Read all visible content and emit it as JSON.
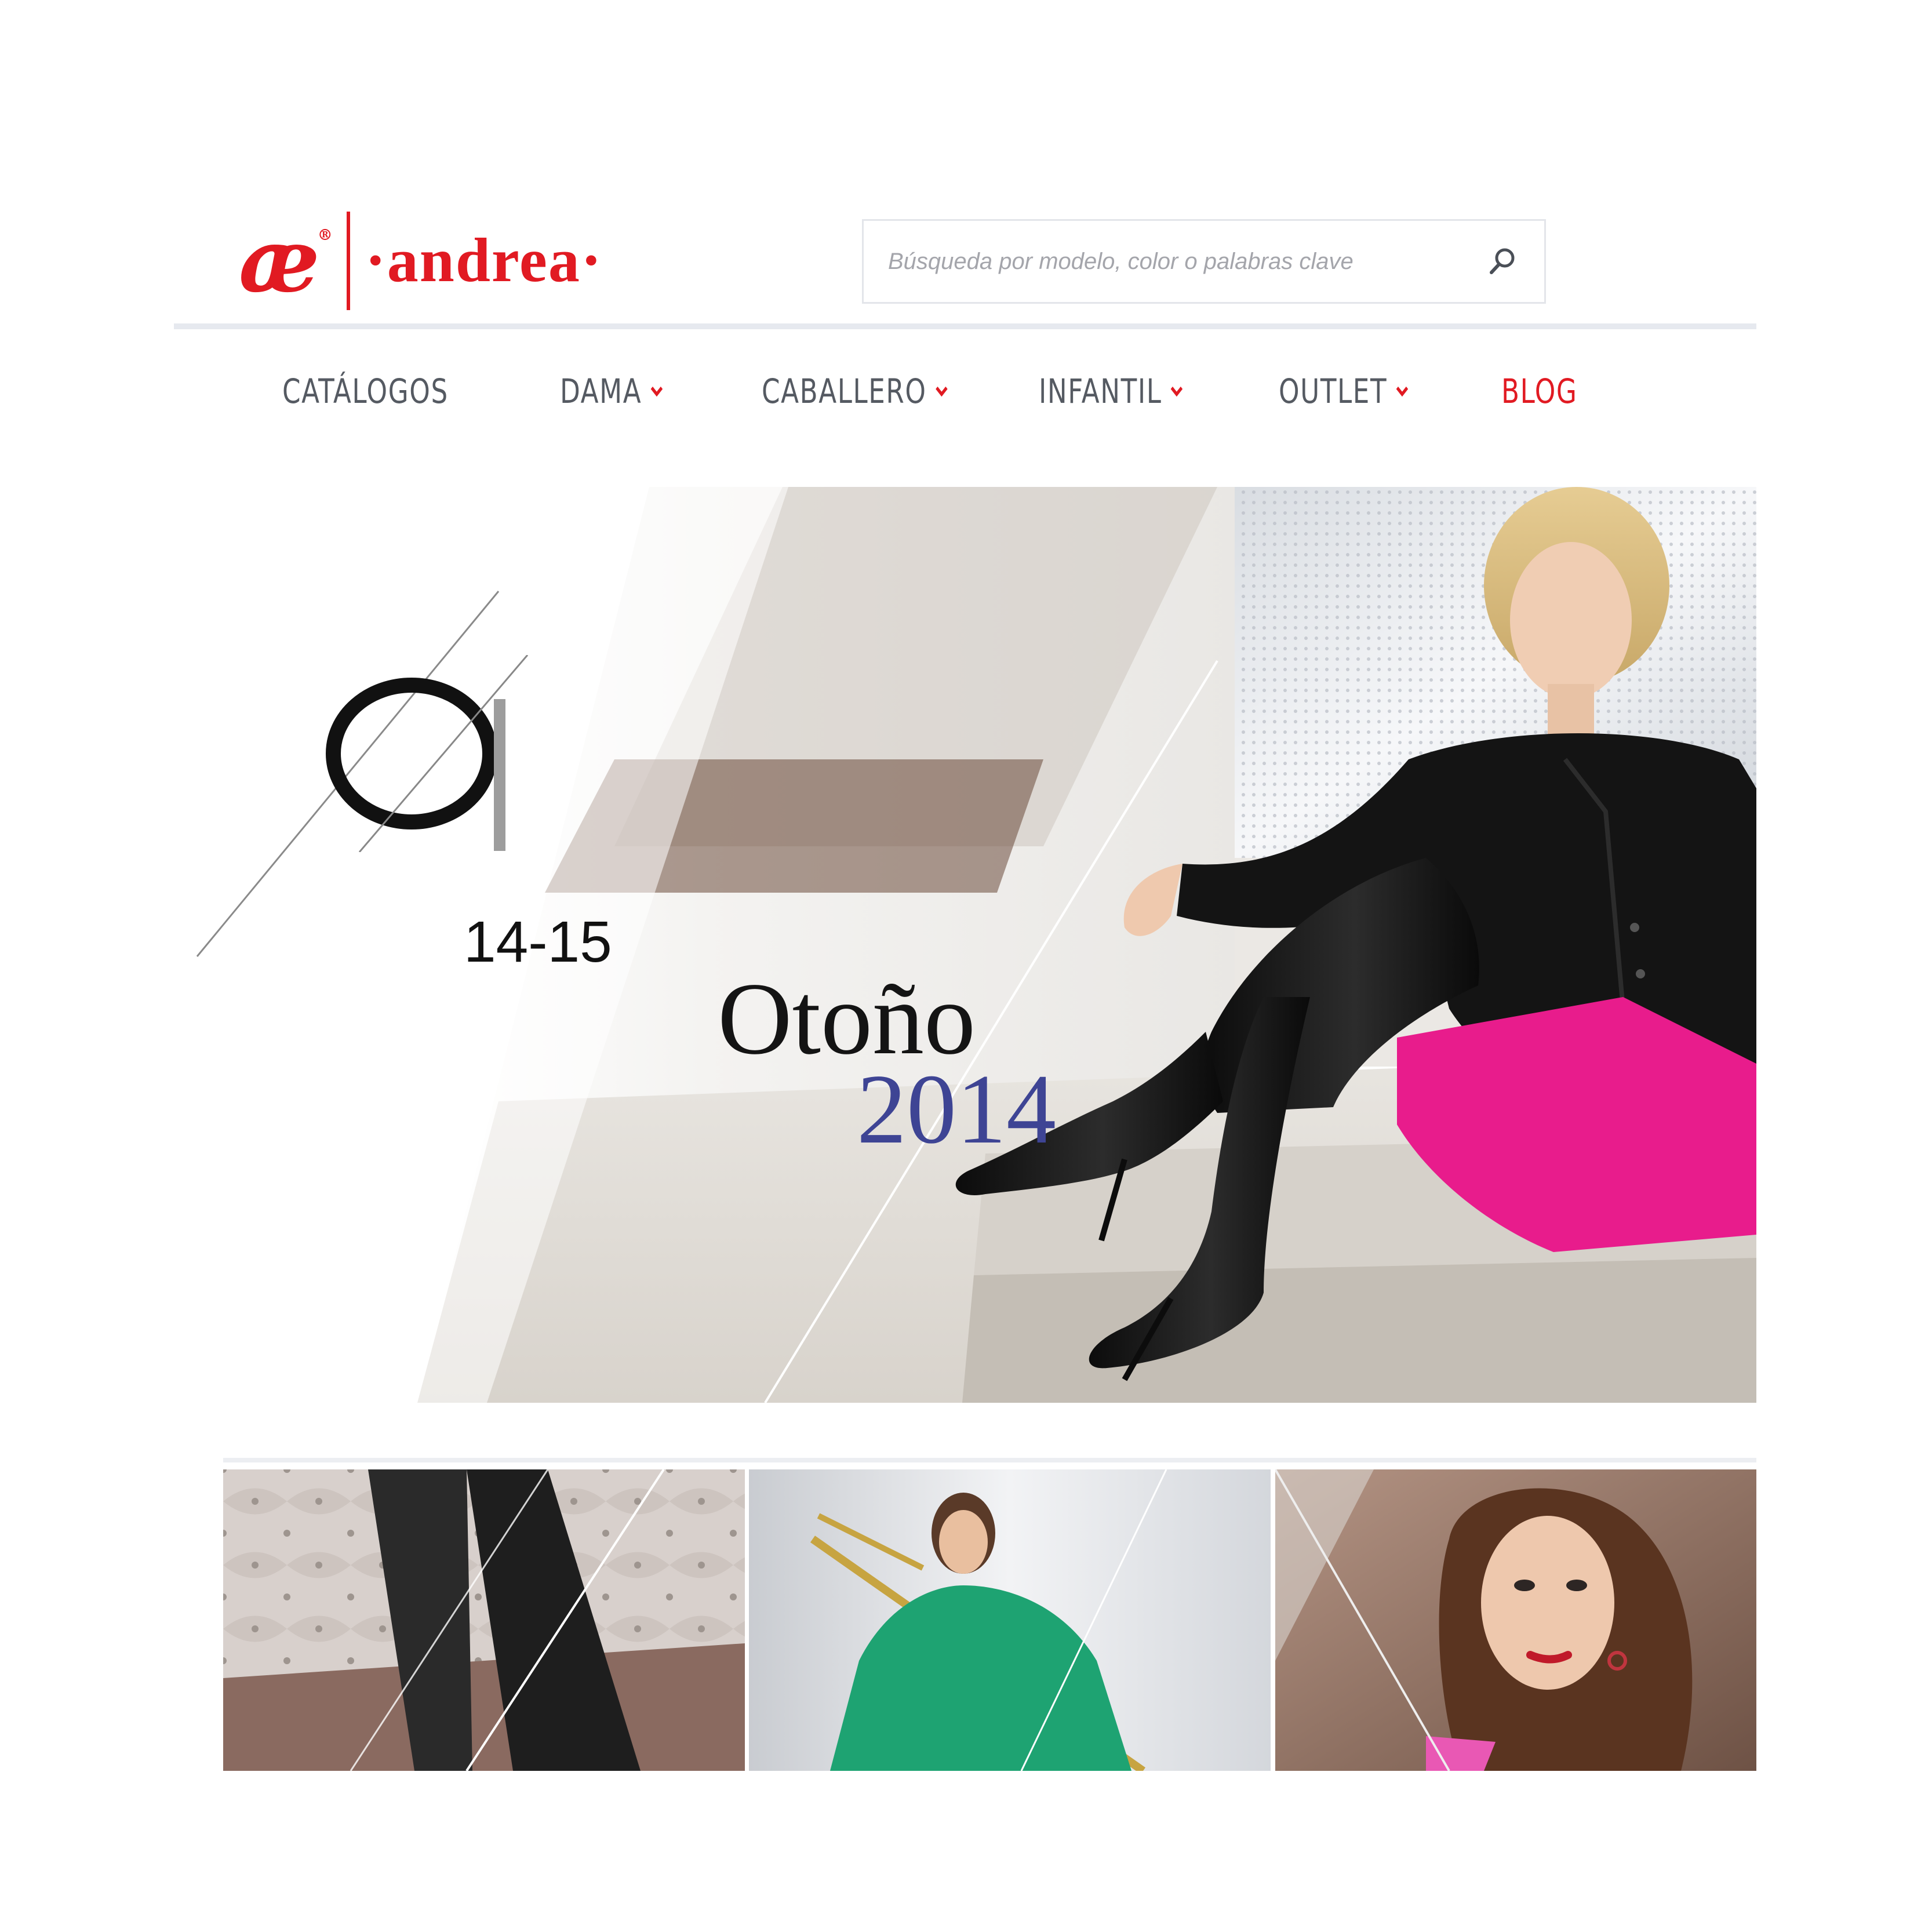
{
  "brand": {
    "mark": "æ",
    "registered": "®",
    "wordmark": "·andrea·",
    "color": "#e11a22"
  },
  "search": {
    "placeholder": "Búsqueda por modelo, color o palabras clave",
    "icon": "search-icon"
  },
  "nav": {
    "items": [
      {
        "label": "CATÁLOGOS",
        "has_dropdown": false
      },
      {
        "label": "DAMA",
        "has_dropdown": true
      },
      {
        "label": "CABALLERO",
        "has_dropdown": true
      },
      {
        "label": "INFANTIL",
        "has_dropdown": true
      },
      {
        "label": "OUTLET",
        "has_dropdown": true
      },
      {
        "label": "BLOG",
        "has_dropdown": false
      }
    ],
    "text_color": "#555a62",
    "accent_color": "#e11a22"
  },
  "hero": {
    "collection_code": "OI",
    "collection_range": "14-15",
    "season": "Otoño",
    "year": "2014",
    "year_color": "#3e4494",
    "skirt_color": "#e81c8c"
  },
  "thumbnails": [
    {
      "subject": "tufted-leather-headboard-with-boots"
    },
    {
      "subject": "woman-in-green-top-with-trombone"
    },
    {
      "subject": "woman-portrait-with-earrings"
    }
  ]
}
